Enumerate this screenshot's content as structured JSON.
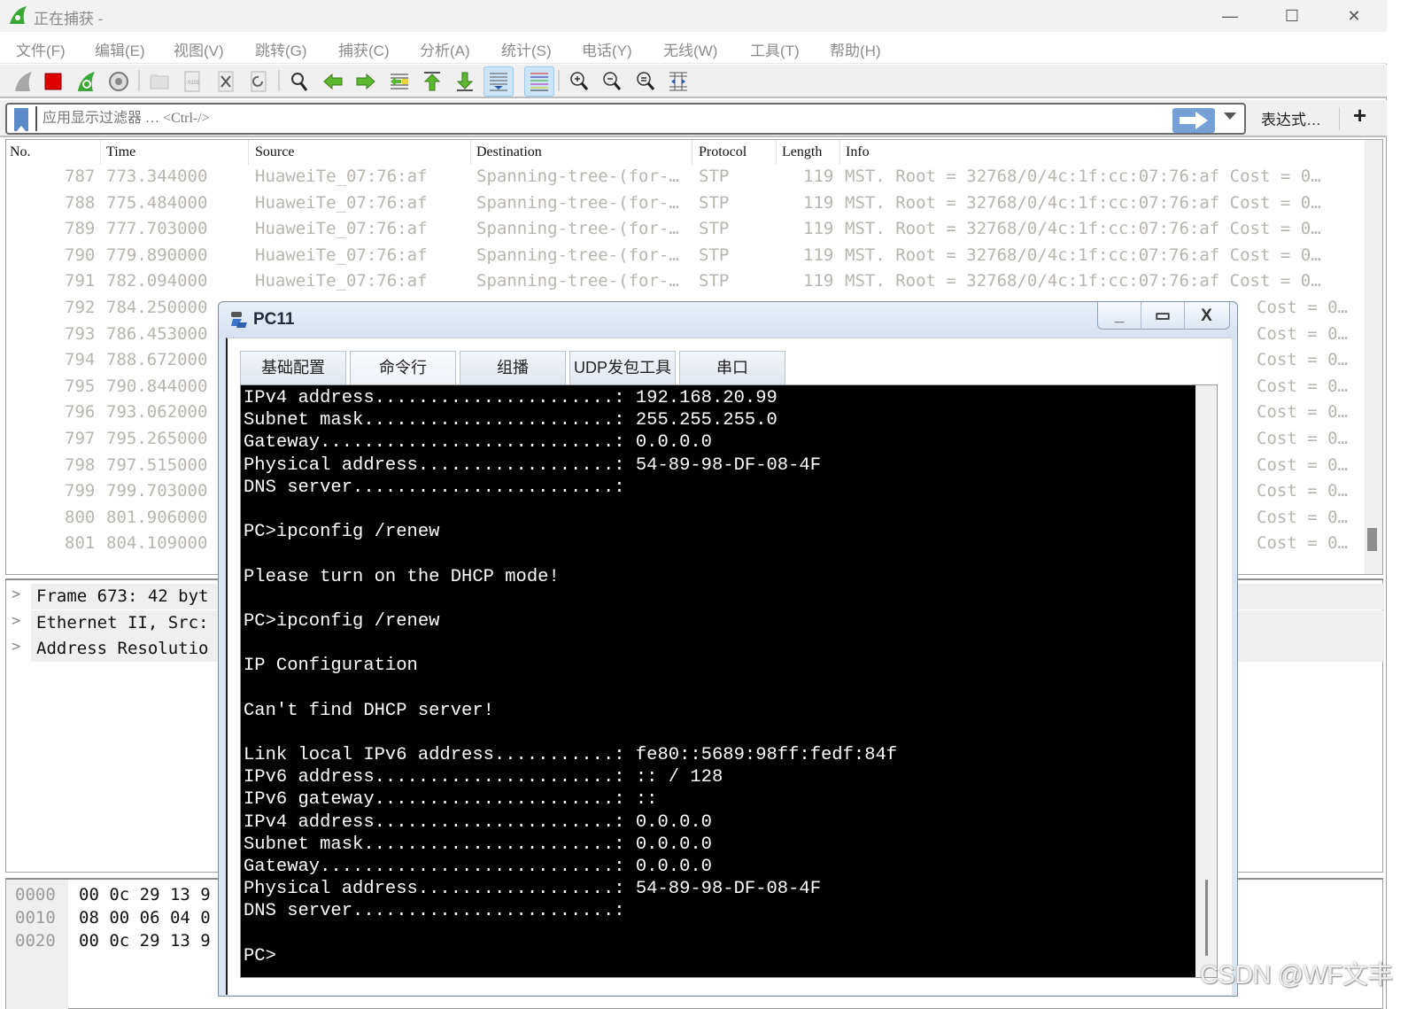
{
  "window": {
    "title": "正在捕获 -",
    "minimize": "—",
    "maximize": "☐",
    "close": "✕"
  },
  "menu": [
    "文件(F)",
    "编辑(E)",
    "视图(V)",
    "跳转(G)",
    "捕获(C)",
    "分析(A)",
    "统计(S)",
    "电话(Y)",
    "无线(W)",
    "工具(T)",
    "帮助(H)"
  ],
  "toolbar": {
    "icons": [
      "start-capture-icon",
      "stop-capture-icon",
      "restart-capture-icon",
      "capture-options-icon",
      "open-file-icon",
      "save-file-icon",
      "close-file-icon",
      "reload-file-icon",
      "find-packet-icon",
      "go-back-icon",
      "go-forward-icon",
      "go-to-packet-icon",
      "go-first-packet-icon",
      "go-last-packet-icon",
      "auto-scroll-icon",
      "colorize-icon",
      "zoom-in-icon",
      "zoom-out-icon",
      "normal-size-icon",
      "resize-columns-icon"
    ]
  },
  "filter": {
    "placeholder": "应用显示过滤器 … <Ctrl-/>",
    "value": "",
    "expression_label": "表达式…",
    "add_label": "+"
  },
  "packet_list": {
    "columns": [
      "No.",
      "Time",
      "Source",
      "Destination",
      "Protocol",
      "Length",
      "Info"
    ],
    "rows": [
      {
        "no": "787",
        "time": "773.344000",
        "source": "HuaweiTe_07:76:af",
        "destination": "Spanning-tree-(for-…",
        "protocol": "STP",
        "length": "119",
        "info": "MST. Root = 32768/0/4c:1f:cc:07:76:af  Cost = 0…"
      },
      {
        "no": "788",
        "time": "775.484000",
        "source": "HuaweiTe_07:76:af",
        "destination": "Spanning-tree-(for-…",
        "protocol": "STP",
        "length": "119",
        "info": "MST. Root = 32768/0/4c:1f:cc:07:76:af  Cost = 0…"
      },
      {
        "no": "789",
        "time": "777.703000",
        "source": "HuaweiTe_07:76:af",
        "destination": "Spanning-tree-(for-…",
        "protocol": "STP",
        "length": "119",
        "info": "MST. Root = 32768/0/4c:1f:cc:07:76:af  Cost = 0…"
      },
      {
        "no": "790",
        "time": "779.890000",
        "source": "HuaweiTe_07:76:af",
        "destination": "Spanning-tree-(for-…",
        "protocol": "STP",
        "length": "119",
        "info": "MST. Root = 32768/0/4c:1f:cc:07:76:af  Cost = 0…"
      },
      {
        "no": "791",
        "time": "782.094000",
        "source": "HuaweiTe_07:76:af",
        "destination": "Spanning-tree-(for-…",
        "protocol": "STP",
        "length": "119",
        "info": "MST. Root = 32768/0/4c:1f:cc:07:76:af  Cost = 0…"
      },
      {
        "no": "792",
        "time": "784.250000",
        "source": "",
        "destination": "",
        "protocol": "",
        "length": "",
        "info": "Cost = 0…"
      },
      {
        "no": "793",
        "time": "786.453000",
        "source": "",
        "destination": "",
        "protocol": "",
        "length": "",
        "info": "Cost = 0…"
      },
      {
        "no": "794",
        "time": "788.672000",
        "source": "",
        "destination": "",
        "protocol": "",
        "length": "",
        "info": "Cost = 0…"
      },
      {
        "no": "795",
        "time": "790.844000",
        "source": "",
        "destination": "",
        "protocol": "",
        "length": "",
        "info": "Cost = 0…"
      },
      {
        "no": "796",
        "time": "793.062000",
        "source": "",
        "destination": "",
        "protocol": "",
        "length": "",
        "info": "Cost = 0…"
      },
      {
        "no": "797",
        "time": "795.265000",
        "source": "",
        "destination": "",
        "protocol": "",
        "length": "",
        "info": "Cost = 0…"
      },
      {
        "no": "798",
        "time": "797.515000",
        "source": "",
        "destination": "",
        "protocol": "",
        "length": "",
        "info": "Cost = 0…"
      },
      {
        "no": "799",
        "time": "799.703000",
        "source": "",
        "destination": "",
        "protocol": "",
        "length": "",
        "info": "Cost = 0…"
      },
      {
        "no": "800",
        "time": "801.906000",
        "source": "",
        "destination": "",
        "protocol": "",
        "length": "",
        "info": "Cost = 0…"
      },
      {
        "no": "801",
        "time": "804.109000",
        "source": "",
        "destination": "",
        "protocol": "",
        "length": "",
        "info": "Cost = 0…"
      }
    ]
  },
  "details": [
    {
      "chevron": ">",
      "text": "Frame 673: 42 byt"
    },
    {
      "chevron": ">",
      "text": "Ethernet II, Src:"
    },
    {
      "chevron": ">",
      "text": "Address Resolutio"
    }
  ],
  "bytes": [
    {
      "offset": "0000",
      "hex": "00 0c 29 13 9"
    },
    {
      "offset": "0010",
      "hex": "08 00 06 04 0"
    },
    {
      "offset": "0020",
      "hex": "00 0c 29 13 9"
    }
  ],
  "dialog": {
    "title": "PC11",
    "minimize": "_",
    "maximize": "▭",
    "close": "X",
    "tabs": [
      "基础配置",
      "命令行",
      "组播",
      "UDP发包工具",
      "串口"
    ],
    "selected_tab": "命令行",
    "terminal_lines": [
      "IPv4 address......................: 192.168.20.99",
      "Subnet mask.......................: 255.255.255.0",
      "Gateway...........................: 0.0.0.0",
      "Physical address..................: 54-89-98-DF-08-4F",
      "DNS server........................:",
      "",
      "PC>ipconfig /renew",
      "",
      "Please turn on the DHCP mode!",
      "",
      "PC>ipconfig /renew",
      "",
      "IP Configuration",
      "",
      "Can't find DHCP server!",
      "",
      "Link local IPv6 address...........: fe80::5689:98ff:fedf:84f",
      "IPv6 address......................: :: / 128",
      "IPv6 gateway......................: ::",
      "IPv4 address......................: 0.0.0.0",
      "Subnet mask.......................: 0.0.0.0",
      "Gateway...........................: 0.0.0.0",
      "Physical address..................: 54-89-98-DF-08-4F",
      "DNS server........................:",
      "",
      "PC>"
    ]
  },
  "watermark": "CSDN @WF文丰",
  "colors": {
    "shark_green": "#3aa836",
    "stop_red": "#e00000",
    "apply_blue": "#75a1d6",
    "packet_text": "#b8b4ae"
  }
}
